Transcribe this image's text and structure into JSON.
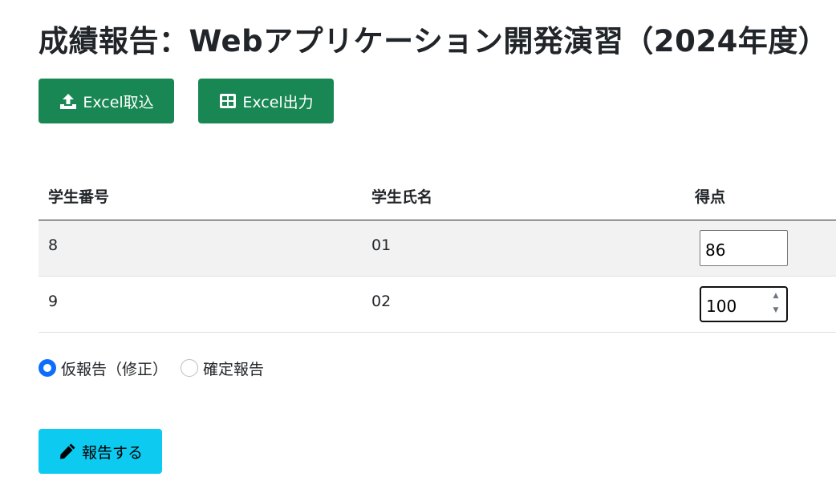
{
  "page": {
    "title": "成績報告：Webアプリケーション開発演習（2024年度）"
  },
  "toolbar": {
    "import_label": "Excel取込",
    "import_icon": "upload-icon",
    "export_label": "Excel出力",
    "export_icon": "table-grid-icon"
  },
  "table": {
    "headers": [
      "学生番号",
      "学生氏名",
      "得点"
    ],
    "rows": [
      {
        "student_id": "8",
        "student_name": "01",
        "score": "86"
      },
      {
        "student_id": "9",
        "student_name": "02",
        "score": "100"
      }
    ]
  },
  "report_type": {
    "options": [
      "仮報告（修正）",
      "確定報告"
    ],
    "selected": "仮報告（修正）"
  },
  "submit": {
    "label": "報告する",
    "icon": "pencil-icon"
  },
  "colors": {
    "success": "#198754",
    "info": "#0dcaf0",
    "radio_selected": "#0d6efd"
  }
}
